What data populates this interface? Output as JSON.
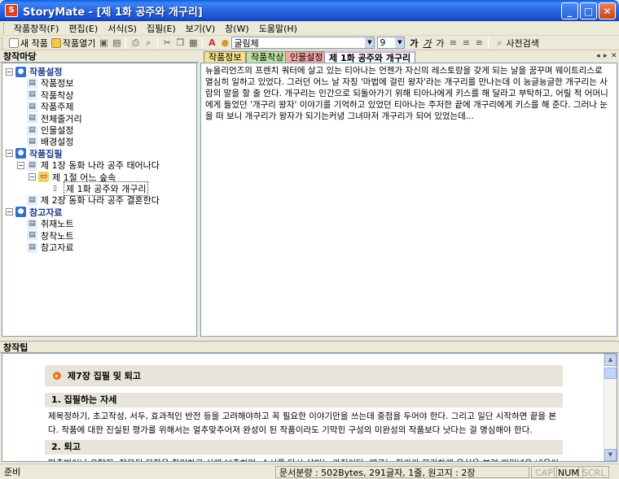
{
  "window": {
    "title": "StoryMate - [제 1화 공주와 개구리]"
  },
  "menu": [
    "작품창작(F)",
    "편집(E)",
    "서식(S)",
    "집필(E)",
    "보기(V)",
    "창(W)",
    "도움말(H)"
  ],
  "toolbar": {
    "new_work": "새 작품",
    "open_work": "작품열기",
    "font_name": "굴림체",
    "font_size": "9",
    "dict_search": "사전검색",
    "fmt_labels": [
      "가",
      "가",
      "가"
    ]
  },
  "left_panel": {
    "title": "창작마당",
    "tree": [
      {
        "label": "작품설정",
        "level": 0,
        "bold": true,
        "expander": "−"
      },
      {
        "label": "작품정보",
        "level": 1
      },
      {
        "label": "작품착상",
        "level": 1
      },
      {
        "label": "작품주제",
        "level": 1
      },
      {
        "label": "전체줄거리",
        "level": 1
      },
      {
        "label": "인물설정",
        "level": 1
      },
      {
        "label": "배경설정",
        "level": 1
      },
      {
        "label": "작품집필",
        "level": 0,
        "bold": true,
        "expander": "−"
      },
      {
        "label": "제 1장 동화 나라 공주 태어나다",
        "level": 1,
        "expander": "−"
      },
      {
        "label": "제 1절 어느 숲속",
        "level": 2,
        "expander": "−"
      },
      {
        "label": "제 1화 공주와 개구리",
        "level": 3,
        "selected": true
      },
      {
        "label": "제 2장 동화 나라 공주 결혼한다",
        "level": 1
      },
      {
        "label": "참고자료",
        "level": 0,
        "bold": true,
        "expander": "−"
      },
      {
        "label": "취재노트",
        "level": 1
      },
      {
        "label": "창작노트",
        "level": 1
      },
      {
        "label": "참고자료",
        "level": 1
      }
    ]
  },
  "tabs": [
    {
      "label": "작품정보",
      "color": "#F6E08E"
    },
    {
      "label": "작품착상",
      "color": "#BFE3A5"
    },
    {
      "label": "인물설정",
      "color": "#F4A6A6"
    },
    {
      "label": "제 1화 공주와 개구리",
      "color": "#C7B3E8",
      "active": true
    }
  ],
  "tab_nav": [
    "◂",
    "▸",
    "✕"
  ],
  "editor": {
    "text": "뉴올리언즈의 프렌치 쿼터에 살고 있는 티아나는 언젠가 자신의 레스토랑을 갖게 되는 날을 꿈꾸며 웨이트리스로 열심히 일하고 있었다. 그러던 어느 날 자칭 '마법에 걸린 왕자'라는 개구리를 만나는데 이 능글능글한 개구리는 사람의 말을 할 줄 안다. 개구리는 인간으로 되돌아가기 위해 티아나에게 키스를 해 달라고 부탁하고, 어릴 적 어머니에게 들었던 '개구리 왕자' 이야기를 기억하고 있었던 티아나는 주저한 끝에 개구리에게 키스를 해 준다. 그러나 눈을 떠 보니 개구리가 왕자가 되기는커녕 그녀마저 개구리가 되어 있었는데..."
  },
  "bottom_panel": {
    "title": "창작팁",
    "tip_title": "제7장 집필 및 퇴고",
    "sections": [
      {
        "heading": "1. 집필하는 자세",
        "text": "제목정하기, 초고작성, 서두, 효과적인 반전 등을 고려해야하고 꼭 필요한 이야기만을 쓰는데 중점을 두어야 한다. 그리고 일단 시작하면 끝을 본다. 작품에 대한 진실된 평가를 위해서는 얼추맞추어져 완성이 된 작품이라도 기막힌 구성의 미완성의 작품보다 낫다는 걸 명심해야 한다."
      },
      {
        "heading": "2. 퇴고",
        "text": "맞춤법이나 오탈자, 잘못된 문장을 확인하고 삭제 보충하며, 순서를 다시 살피는 과정이다. 때로는 작가가 무리하게 욕심을 부려 끼워넣은 내용이라"
      }
    ]
  },
  "statusbar": {
    "left": "준비",
    "info": "문서분량 : 502Bytes, 291글자, 1줄, 원고지 : 2장",
    "cap": "CAP",
    "num": "NUM",
    "scrl": "SCRL"
  }
}
